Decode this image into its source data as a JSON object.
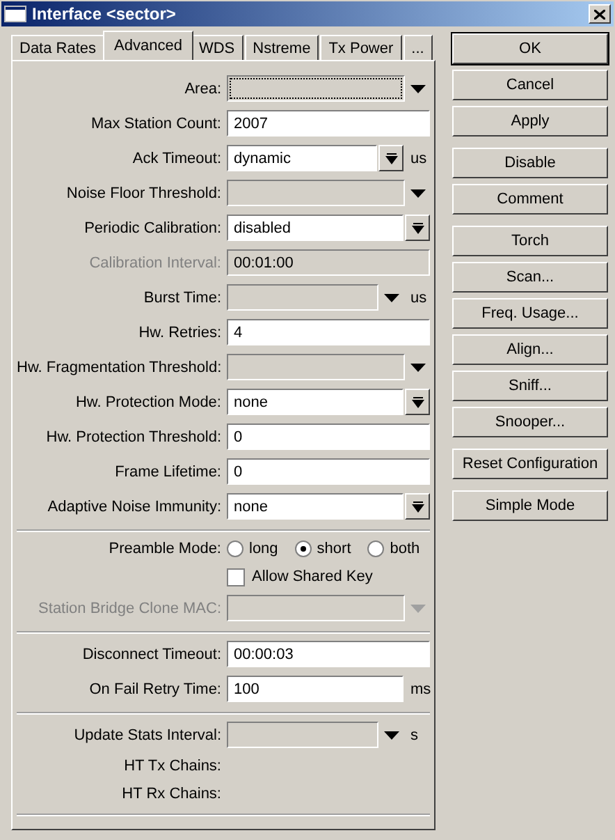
{
  "window": {
    "title": "Interface <sector>"
  },
  "tabs": [
    {
      "label": "Data Rates",
      "selected": false
    },
    {
      "label": "Advanced",
      "selected": true
    },
    {
      "label": "WDS",
      "selected": false
    },
    {
      "label": "Nstreme",
      "selected": false
    },
    {
      "label": "Tx Power",
      "selected": false
    },
    {
      "label": "...",
      "selected": false
    }
  ],
  "sections": [
    {
      "rows": [
        {
          "kind": "dropdown",
          "label": "Area:",
          "focused": true,
          "disabled": false
        },
        {
          "kind": "text",
          "label": "Max Station Count:",
          "value": "2007",
          "disabled": false
        },
        {
          "kind": "combo",
          "label": "Ack Timeout:",
          "value": "dynamic",
          "unit": "us",
          "disabled": false
        },
        {
          "kind": "dropdown",
          "label": "Noise Floor Threshold:",
          "focused": false,
          "disabled": false
        },
        {
          "kind": "combo",
          "label": "Periodic Calibration:",
          "value": "disabled",
          "disabled": false
        },
        {
          "kind": "text",
          "label": "Calibration Interval:",
          "value": "00:01:00",
          "disabled": true
        },
        {
          "kind": "dropdown",
          "label": "Burst Time:",
          "unit": "us",
          "focused": false,
          "disabled": false
        },
        {
          "kind": "text",
          "label": "Hw. Retries:",
          "value": "4",
          "disabled": false
        },
        {
          "kind": "dropdown",
          "label": "Hw. Fragmentation Threshold:",
          "focused": false,
          "disabled": false
        },
        {
          "kind": "combo",
          "label": "Hw. Protection Mode:",
          "value": "none",
          "disabled": false
        },
        {
          "kind": "text",
          "label": "Hw. Protection Threshold:",
          "value": "0",
          "disabled": false
        },
        {
          "kind": "text",
          "label": "Frame Lifetime:",
          "value": "0",
          "disabled": false
        },
        {
          "kind": "combo",
          "label": "Adaptive Noise Immunity:",
          "value": "none",
          "disabled": false
        }
      ]
    },
    {
      "rows": [
        {
          "kind": "radio",
          "label": "Preamble Mode:",
          "options": [
            {
              "label": "long",
              "selected": false
            },
            {
              "label": "short",
              "selected": true
            },
            {
              "label": "both",
              "selected": false
            }
          ]
        },
        {
          "kind": "checkbox",
          "text": "Allow Shared Key",
          "checked": false
        },
        {
          "kind": "dropdown",
          "label": "Station Bridge Clone MAC:",
          "focused": false,
          "disabled": true
        }
      ]
    },
    {
      "rows": [
        {
          "kind": "text",
          "label": "Disconnect Timeout:",
          "value": "00:00:03",
          "disabled": false
        },
        {
          "kind": "text",
          "label": "On Fail Retry Time:",
          "value": "100",
          "unit": "ms",
          "disabled": false
        }
      ]
    },
    {
      "rows": [
        {
          "kind": "dropdown",
          "label": "Update Stats Interval:",
          "unit": "s",
          "focused": false,
          "disabled": false
        },
        {
          "kind": "label",
          "label": "HT Tx Chains:"
        },
        {
          "kind": "label",
          "label": "HT Rx Chains:"
        }
      ]
    }
  ],
  "button_groups": [
    [
      {
        "label": "OK",
        "default": true
      },
      {
        "label": "Cancel",
        "default": false
      },
      {
        "label": "Apply",
        "default": false
      }
    ],
    [
      {
        "label": "Disable",
        "default": false
      },
      {
        "label": "Comment",
        "default": false
      }
    ],
    [
      {
        "label": "Torch",
        "default": false
      },
      {
        "label": "Scan...",
        "default": false
      },
      {
        "label": "Freq. Usage...",
        "default": false
      },
      {
        "label": "Align...",
        "default": false
      },
      {
        "label": "Sniff...",
        "default": false
      },
      {
        "label": "Snooper...",
        "default": false
      }
    ],
    [
      {
        "label": "Reset Configuration",
        "default": false
      }
    ],
    [
      {
        "label": "Simple Mode",
        "default": false
      }
    ]
  ]
}
